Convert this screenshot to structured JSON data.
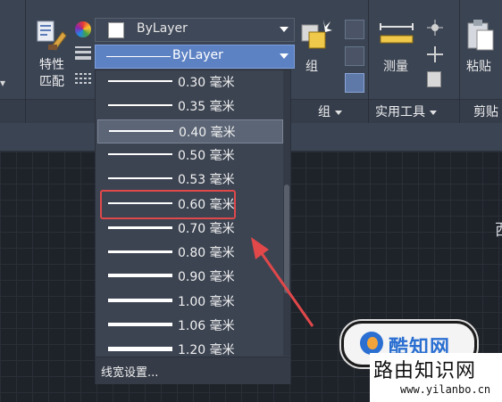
{
  "ribbon": {
    "match_properties_label": "特性\n匹配",
    "color_combo": {
      "value": "ByLayer",
      "color": "#ffffff"
    },
    "lineweight_combo": {
      "value": "ByLayer"
    },
    "group_label": "组",
    "measure_label": "测量",
    "paste_label": "粘贴",
    "footer": {
      "group_panel": "组",
      "utilities_panel": "实用工具",
      "clipboard_panel": "剪贴"
    },
    "partial_right_text": "西"
  },
  "lineweight_dropdown": {
    "items": [
      {
        "label": "0.30 毫米",
        "weight": 0.3
      },
      {
        "label": "0.35 毫米",
        "weight": 0.35
      },
      {
        "label": "0.40 毫米",
        "weight": 0.4
      },
      {
        "label": "0.50 毫米",
        "weight": 0.5
      },
      {
        "label": "0.53 毫米",
        "weight": 0.53
      },
      {
        "label": "0.60 毫米",
        "weight": 0.6
      },
      {
        "label": "0.70 毫米",
        "weight": 0.7
      },
      {
        "label": "0.80 毫米",
        "weight": 0.8
      },
      {
        "label": "0.90 毫米",
        "weight": 0.9
      },
      {
        "label": "1.00 毫米",
        "weight": 1.0
      },
      {
        "label": "1.06 毫米",
        "weight": 1.06
      },
      {
        "label": "1.20 毫米",
        "weight": 1.2
      }
    ],
    "hovered_label": "0.40 毫米",
    "highlighted_label": "0.60 毫米",
    "settings_label": "线宽设置..."
  },
  "watermark": {
    "badge_text": "酷知网",
    "title": "路由知识网",
    "url": "www.yilanbo.cn"
  },
  "colors": {
    "ribbon_bg": "#3b4453",
    "selection_blue": "#5d82c4",
    "annotation_red": "#e0484a"
  }
}
